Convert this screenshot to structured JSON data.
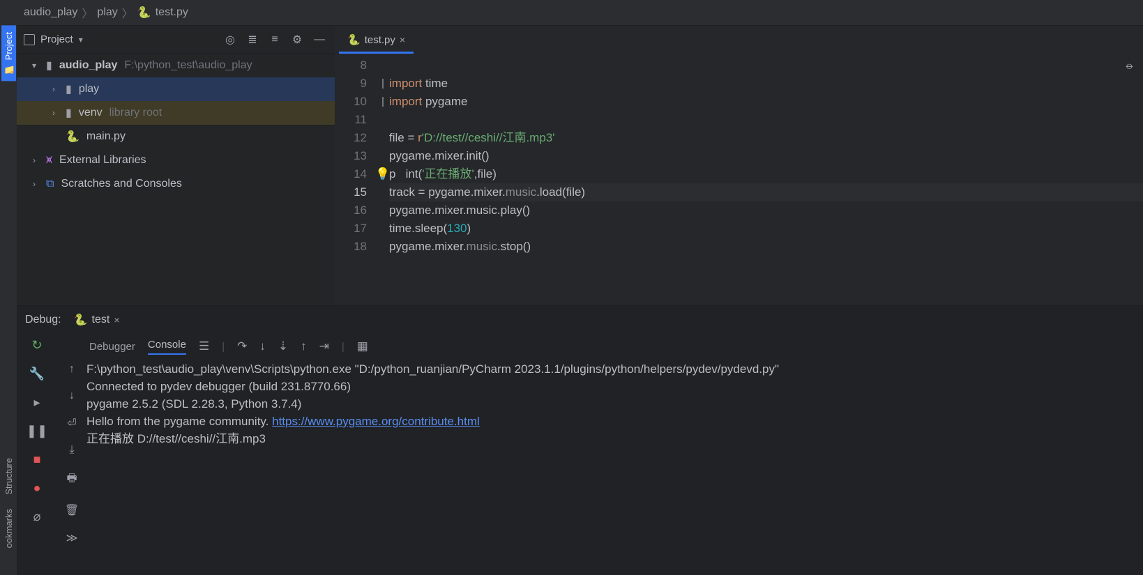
{
  "breadcrumb": [
    "audio_play",
    "play",
    "test.py"
  ],
  "project": {
    "title": "Project",
    "root": {
      "name": "audio_play",
      "path": "F:\\python_test\\audio_play"
    },
    "children": [
      {
        "name": "play",
        "kind": "folder"
      },
      {
        "name": "venv",
        "kind": "folder",
        "note": "library root"
      },
      {
        "name": "main.py",
        "kind": "py"
      }
    ],
    "external": "External Libraries",
    "scratches": "Scratches and Consoles"
  },
  "editor": {
    "tab": "test.py",
    "gutter_start": 8,
    "current_line": 15,
    "lines": [
      "",
      "import time",
      "import pygame",
      "",
      "file = r'D://test//ceshi//江南.mp3'",
      "pygame.mixer.init()",
      "print('正在播放',file)",
      "track = pygame.mixer.music.load(file)",
      "pygame.mixer.music.play()",
      "time.sleep(130)",
      "pygame.mixer.music.stop()"
    ]
  },
  "debug": {
    "label": "Debug:",
    "run_name": "test",
    "tabs": {
      "debugger": "Debugger",
      "console": "Console"
    },
    "console": [
      "F:\\python_test\\audio_play\\venv\\Scripts\\python.exe \"D:/python_ruanjian/PyCharm 2023.1.1/plugins/python/helpers/pydev/pydevd.py\"",
      "Connected to pydev debugger (build 231.8770.66)",
      "pygame 2.5.2 (SDL 2.28.3, Python 3.7.4)",
      "Hello from the pygame community. ",
      "正在播放 D://test//ceshi//江南.mp3"
    ],
    "link": "https://www.pygame.org/contribute.html"
  }
}
